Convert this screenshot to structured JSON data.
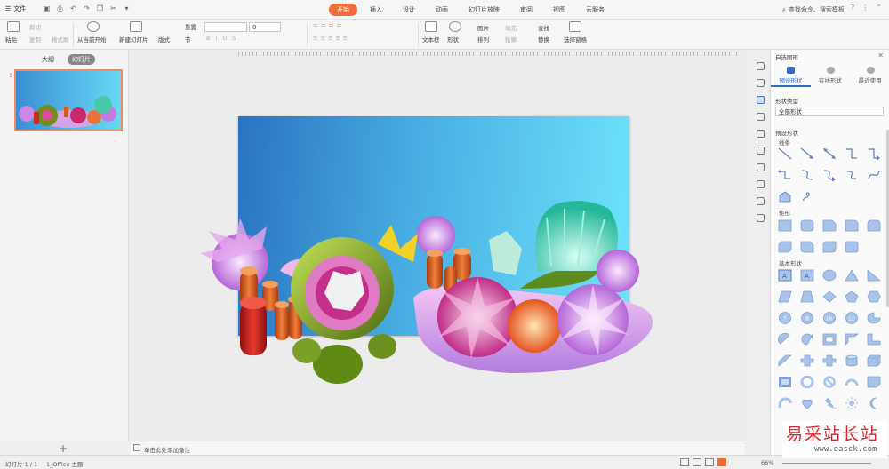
{
  "menu": {
    "file_label": "文件"
  },
  "tabs": [
    {
      "label": "开始",
      "active": true
    },
    {
      "label": "插入"
    },
    {
      "label": "设计"
    },
    {
      "label": "动画"
    },
    {
      "label": "幻灯片放映"
    },
    {
      "label": "审阅"
    },
    {
      "label": "视图"
    },
    {
      "label": "云服务"
    }
  ],
  "search": {
    "label": "查找命令、搜索模板"
  },
  "ribbon": {
    "paste": "粘贴",
    "cut": "剪切",
    "copy": "复制",
    "format_painter": "格式刷",
    "from_current": "从当前开始",
    "new_slide": "新建幻灯片",
    "layout": "版式",
    "reset": "重置",
    "section": "节",
    "font_size": "0",
    "textbox": "文本框",
    "shape": "形状",
    "picture": "图片",
    "arrange": "排列",
    "fill": "填充",
    "outline": "轮廓",
    "find": "查找",
    "replace": "替换",
    "select_pane": "选择窗格"
  },
  "left_panel": {
    "tab_outline": "大纲",
    "tab_slides": "幻灯片",
    "slide_number": "1"
  },
  "notes": {
    "placeholder": "单击此处添加备注"
  },
  "status": {
    "slide_info": "幻灯片 1 / 1",
    "theme": "1_Office 主题",
    "zoom": "66%"
  },
  "right_panel": {
    "title": "自选图形",
    "tabs": [
      "预设形状",
      "在线形状",
      "最近使用"
    ],
    "shape_type_label": "形状类型",
    "shape_type_value": "全部形状",
    "preset_label": "预设形状",
    "cat_lines": "线条",
    "cat_rect": "矩形",
    "cat_basic": "基本形状",
    "num_shapes": [
      "7",
      "8",
      "10",
      "12"
    ]
  },
  "watermark": {
    "cn": "易采站长站",
    "en": "www.easck.com"
  },
  "colors": {
    "accent": "#f26b3a",
    "panel_blue": "#2b6cc4",
    "shape_fill": "#a9c4ea"
  }
}
